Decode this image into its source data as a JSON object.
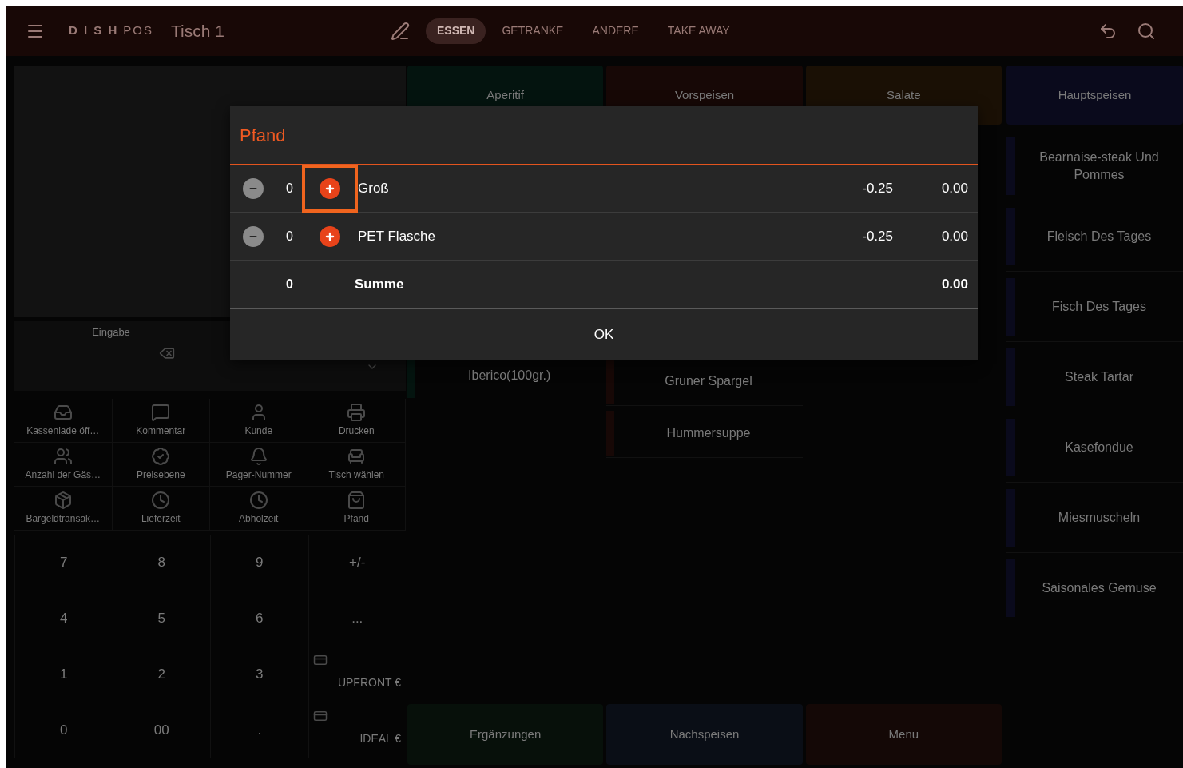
{
  "top_bar": {
    "brand": "D I S H",
    "brand_suffix": "POS",
    "table": "Tisch 1",
    "tabs": [
      {
        "label": "ESSEN",
        "selected": true
      },
      {
        "label": "GETRANKE",
        "selected": false
      },
      {
        "label": "ANDERE",
        "selected": false
      },
      {
        "label": "TAKE AWAY",
        "selected": false
      }
    ]
  },
  "order_panel": {
    "input_label": "Eingabe"
  },
  "functions": [
    {
      "label": "Kassenlade öff…"
    },
    {
      "label": "Kommentar"
    },
    {
      "label": "Kunde"
    },
    {
      "label": "Drucken"
    },
    {
      "label": "Anzahl der Gäs…"
    },
    {
      "label": "Preisebene"
    },
    {
      "label": "Pager-Nummer"
    },
    {
      "label": "Tisch wählen"
    },
    {
      "label": "Bargeldtransak…"
    },
    {
      "label": "Lieferzeit"
    },
    {
      "label": "Abholzeit"
    },
    {
      "label": "Pfand"
    }
  ],
  "numpad": [
    {
      "label": "7",
      "kind": "key"
    },
    {
      "label": "8",
      "kind": "key"
    },
    {
      "label": "9",
      "kind": "key"
    },
    {
      "label": "+/-",
      "kind": "key"
    },
    {
      "label": "4",
      "kind": "key"
    },
    {
      "label": "5",
      "kind": "key"
    },
    {
      "label": "6",
      "kind": "key"
    },
    {
      "label": "...",
      "kind": "key"
    },
    {
      "label": "1",
      "kind": "key"
    },
    {
      "label": "2",
      "kind": "key"
    },
    {
      "label": "3",
      "kind": "key"
    },
    {
      "label": "UPFRONT €",
      "kind": "payment"
    },
    {
      "label": "0",
      "kind": "key"
    },
    {
      "label": "00",
      "kind": "key"
    },
    {
      "label": ".",
      "kind": "key"
    },
    {
      "label": "IDEAL €",
      "kind": "payment"
    }
  ],
  "category_columns": [
    {
      "label": "Aperitif",
      "color": "#04140f",
      "items": [
        "Iberico(100gr.)"
      ]
    },
    {
      "label": "Vorspeisen",
      "color": "#170806",
      "items": [
        "Gruner Spargel",
        "Hummersuppe"
      ]
    },
    {
      "label": "Salate",
      "color": "#1a1005"
    }
  ],
  "main_category": {
    "label": "Hauptspeisen",
    "color": "#0a0a1c",
    "items": [
      "Bearnaise-steak Und Pommes",
      "Fleisch Des Tages",
      "Fisch Des Tages",
      "Steak Tartar",
      "Kasefondue",
      "Miesmuscheln",
      "Saisonales Gemuse"
    ]
  },
  "bottom_categories": [
    {
      "label": "Ergänzungen",
      "color": "#07100a"
    },
    {
      "label": "Nachspeisen",
      "color": "#0a0e16"
    },
    {
      "label": "Menu",
      "color": "#140806"
    }
  ],
  "dialog": {
    "title": "Pfand",
    "rows": [
      {
        "qty": "0",
        "name": "Groß",
        "unit_price": "-0.25",
        "total": "0.00",
        "highlighted": true
      },
      {
        "qty": "0",
        "name": "PET Flasche",
        "unit_price": "-0.25",
        "total": "0.00",
        "highlighted": false
      }
    ],
    "sum": {
      "qty": "0",
      "label": "Summe",
      "total": "0.00"
    },
    "ok": "OK"
  }
}
